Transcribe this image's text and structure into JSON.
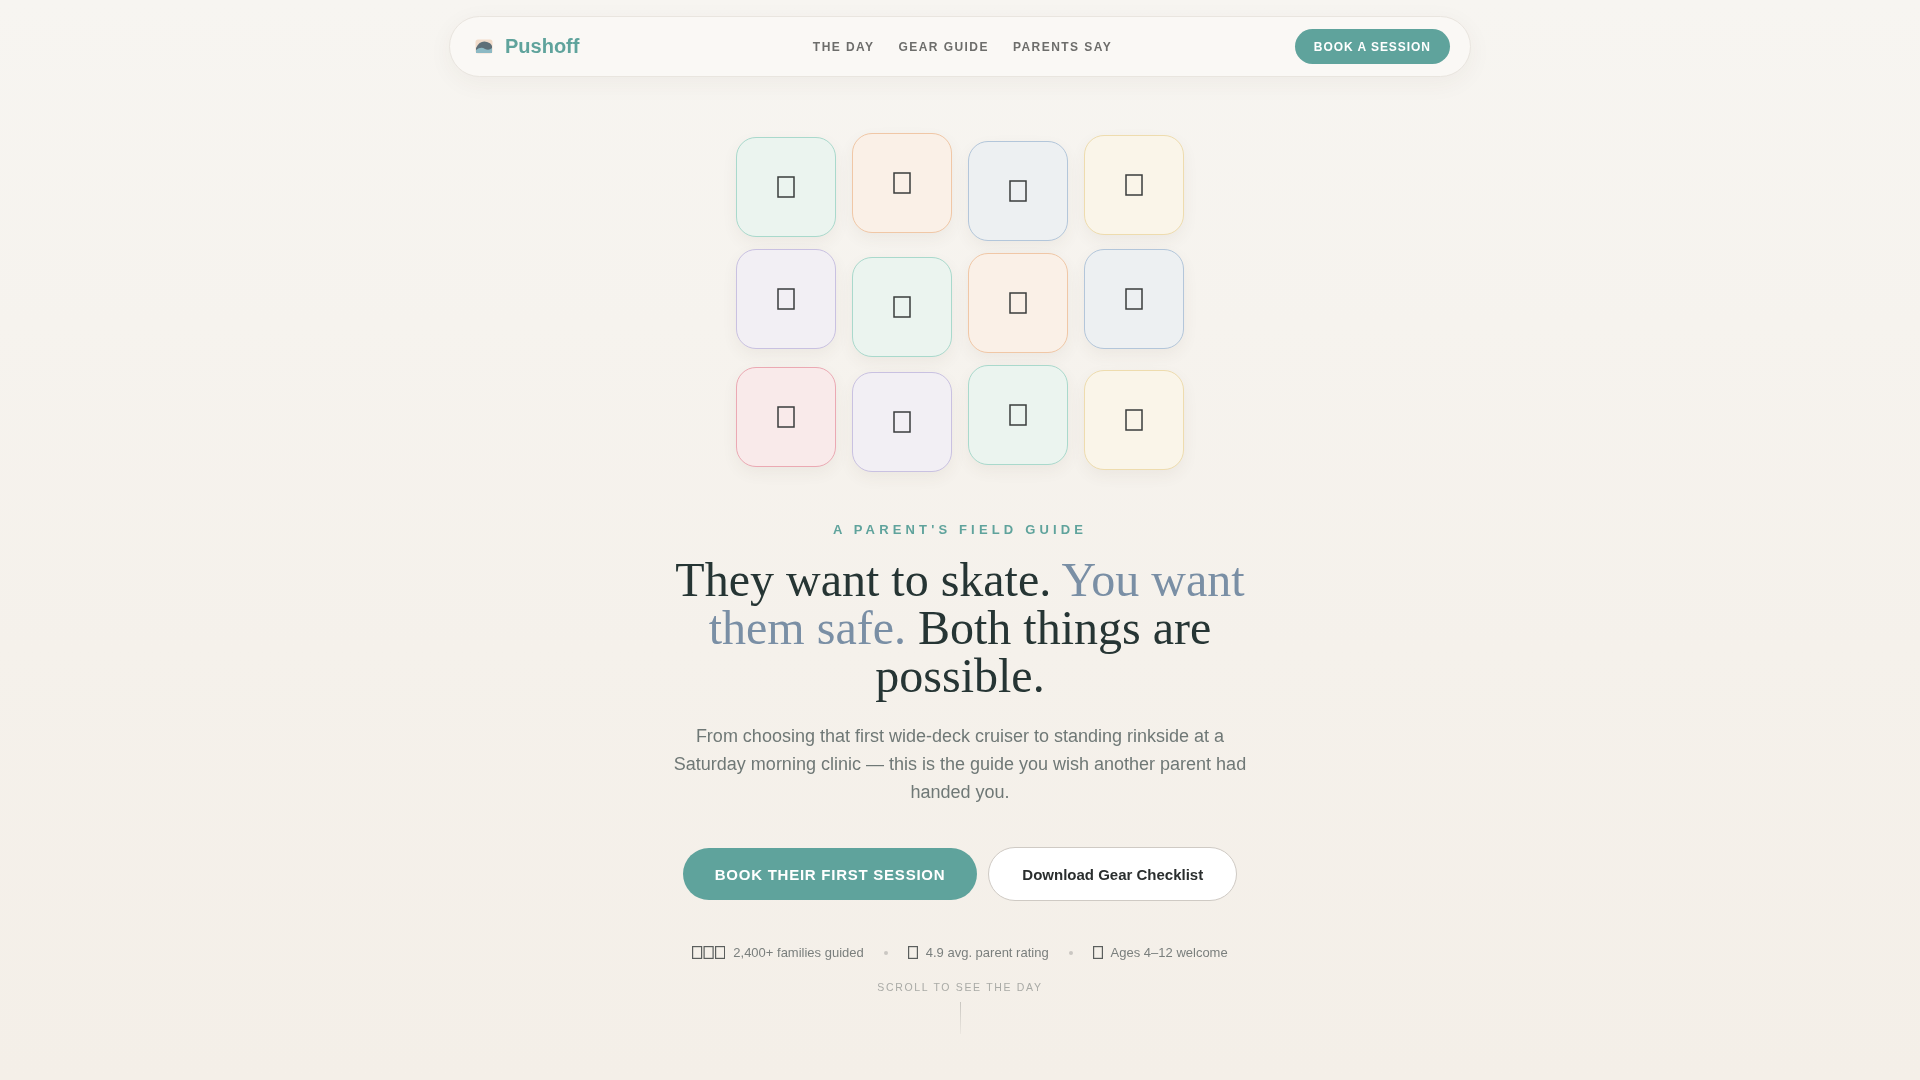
{
  "nav": {
    "logo": "Pushoff",
    "links": [
      "THE DAY",
      "GEAR GUIDE",
      "PARENTS SAY"
    ],
    "cta": "BOOK A SESSION"
  },
  "tiles": [
    {
      "color": "#a9d9cc"
    },
    {
      "color": "#f0c7a6"
    },
    {
      "color": "#b3c6da"
    },
    {
      "color": "#eedcae"
    },
    {
      "color": "#c9c1e1"
    },
    {
      "color": "#a9d9cc"
    },
    {
      "color": "#f0c7a6"
    },
    {
      "color": "#b3c6da"
    },
    {
      "color": "#eba9b3"
    },
    {
      "color": "#c9c1e1"
    },
    {
      "color": "#a9d9cc"
    },
    {
      "color": "#eedcae"
    }
  ],
  "hero": {
    "eyebrow": "A PARENT'S FIELD GUIDE",
    "headline": [
      {
        "text": "They want to skate. ",
        "accent": false
      },
      {
        "text": "You want them safe.",
        "accent": true
      },
      {
        "text": " Both things are possible.",
        "accent": false
      }
    ],
    "lede": "From choosing that first wide-deck cruiser to standing rinkside at a Saturday morning clinic — this is the guide you wish another parent had handed you.",
    "primary_button": "BOOK THEIR FIRST SESSION",
    "secondary_button": "Download Gear Checklist"
  },
  "stats": [
    {
      "kind": "triple",
      "text": "2,400+ families guided"
    },
    {
      "kind": "single",
      "text": "4.9 avg. parent rating"
    },
    {
      "kind": "single",
      "text": "Ages 4–12 welcome"
    }
  ],
  "scroll_hint": "SCROLL TO SEE THE DAY"
}
